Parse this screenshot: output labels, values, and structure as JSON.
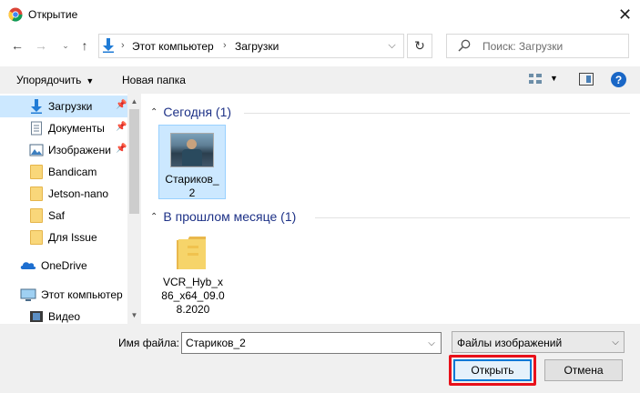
{
  "window": {
    "title": "Открытие",
    "close": "✕"
  },
  "address": {
    "path": [
      "Этот компьютер",
      "Загрузки"
    ],
    "separator": "›",
    "search_placeholder": "Поиск: Загрузки"
  },
  "toolbar": {
    "organize": "Упорядочить",
    "new_folder": "Новая папка",
    "help": "?"
  },
  "nav": {
    "items": [
      {
        "label": "Загрузки",
        "icon": "download-arrow-icon",
        "pinned": true,
        "selected": true
      },
      {
        "label": "Документы",
        "icon": "document-icon",
        "pinned": true
      },
      {
        "label": "Изображени",
        "icon": "pictures-icon",
        "pinned": true
      },
      {
        "label": "Bandicam",
        "icon": "folder-icon"
      },
      {
        "label": "Jetson-nano",
        "icon": "folder-icon"
      },
      {
        "label": "Saf",
        "icon": "folder-icon"
      },
      {
        "label": "Для Issue",
        "icon": "folder-icon"
      },
      {
        "label": "OneDrive",
        "icon": "onedrive-cloud-icon"
      },
      {
        "label": "Этот компьютер",
        "icon": "computer-icon"
      },
      {
        "label": "Видео",
        "icon": "video-icon"
      }
    ]
  },
  "groups": [
    {
      "header": "Сегодня (1)",
      "files": [
        {
          "name": "Стариков_2",
          "type": "image"
        }
      ]
    },
    {
      "header": "В прошлом месяце (1)",
      "files": [
        {
          "name": "VCR_Hyb_x86_x64_09.08.2020",
          "type": "folder"
        }
      ]
    }
  ],
  "file_labels": {
    "starikov": [
      "Стариков_",
      "2"
    ],
    "vcr": [
      "VCR_Hyb_x",
      "86_x64_09.0",
      "8.2020"
    ]
  },
  "bottom": {
    "filename_label": "Имя файла:",
    "filename_value": "Стариков_2",
    "filter_value": "Файлы изображений",
    "open_label": "Открыть",
    "cancel_label": "Отмена"
  },
  "colors": {
    "accent": "#0078d7",
    "highlight": "#e8101a",
    "selection": "#cce8ff"
  }
}
